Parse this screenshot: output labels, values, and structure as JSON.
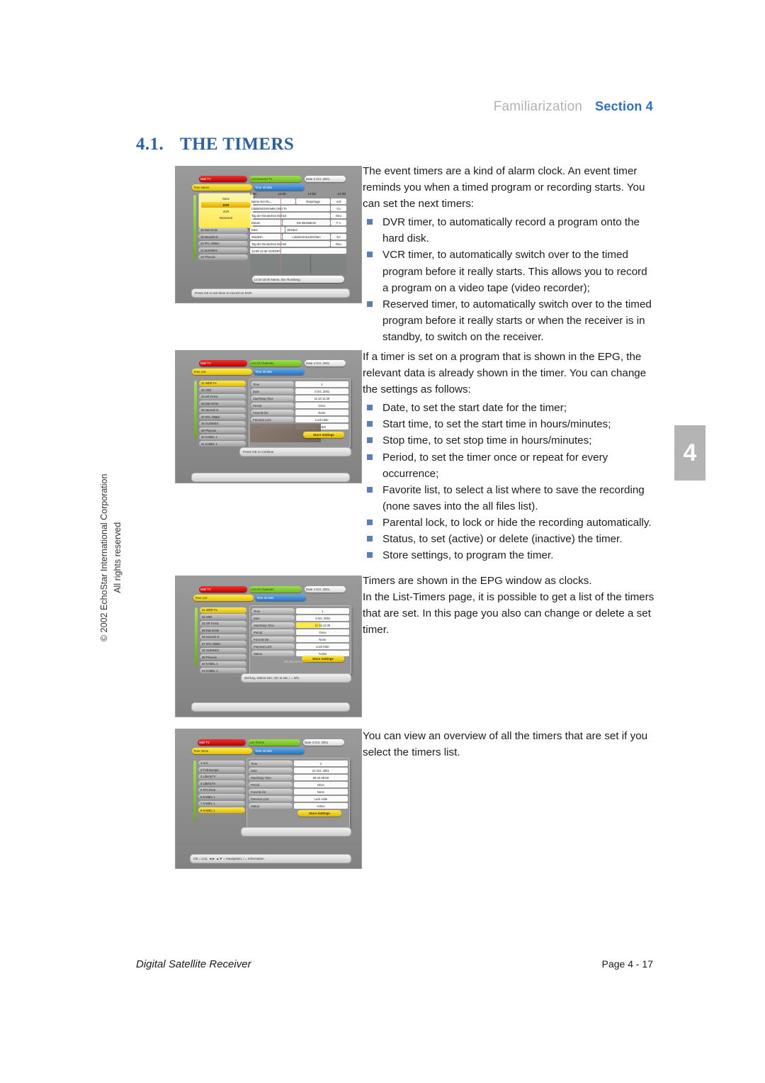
{
  "header": {
    "chapter": "Familiarization",
    "section": "Section 4"
  },
  "section_tab": {
    "number": "4"
  },
  "heading": {
    "number": "4.1.",
    "title": "THE TIMERS"
  },
  "copyright": {
    "line1": "© 2002 EchoStar International Corporation",
    "line2": "All rights reserved"
  },
  "body": {
    "p1": "The event timers are a kind of alarm clock. An event timer reminds you when a timed program or recording starts. You can set the next timers:",
    "list1": [
      "DVR timer, to automatically record a program onto the hard disk.",
      "VCR timer, to automatically switch over to the timed program before it really starts. This allows you to record a program on a video tape (video recorder);",
      "Reserved timer, to automatically switch over to the timed program before it really starts or when the receiver is in standby, to switch on the receiver."
    ],
    "p2": "If a timer is set on a program that is shown in the EPG, the relevant data is already shown in the timer. You can change the settings as follows:",
    "list2": [
      "Date, to set the start date for the timer;",
      "Start time, to set the start time in hours/minutes;",
      "Stop time, to set stop time in hours/minutes;",
      "Period, to set the timer once or repeat for every occurrence;",
      "Favorite list, to select a list where to save the recording (none saves into the all files list).",
      "Parental lock, to lock or hide the recording automatically.",
      "Status, to set (active) or delete (inactive) the timer.",
      "Store settings, to program the timer."
    ],
    "p3": "Timers are shown in the EPG window as clocks.",
    "p4": "In the List-Timers page, it is possible to get a list of the timers that are set. In this page you also can change or delete a set timer.",
    "p5": "You can view an overview of all the timers that are set if you select the timers list."
  },
  "screenshots": [
    {
      "id": "epg-timer-select",
      "caption_bar": "Press OK to set timer to record on DVR",
      "top_bars": {
        "red": "Mail        TV",
        "green": "List     General TV",
        "white": "Date  2 Oct. 2001"
      },
      "second_bars": {
        "yellow": "Time        Name",
        "blue": "Time      30 Min"
      },
      "timer_menu": [
        "None",
        "DVR",
        "VCR",
        "Reserved"
      ],
      "time_headers": [
        "5:00",
        "13:30",
        "14:00",
        "14:30"
      ],
      "channels": [
        "16  Das Erste",
        "16  Neuseh N",
        "20  RTL-GBBA",
        "11  SUDWES",
        "15  Phoenix"
      ],
      "epg_rows": [
        {
          "label": "Name  Der Ru...",
          "value": "Reportage",
          "tag": "Ard"
        },
        {
          "label": "LIEBENSGRAMM UND TA",
          "value": "",
          "tag": "Co"
        },
        {
          "label": "Tag der Deutschen Einheit",
          "value": "",
          "tag": "Deu"
        },
        {
          "label": "Datum",
          "value": "Die Bestatterin",
          "tag": "F 1"
        },
        {
          "label": "Date",
          "value": "Oktober",
          "tag": ""
        },
        {
          "label": "Wiederh.",
          "value": "Lokalzeit-Nachrichten",
          "tag": "Ko"
        },
        {
          "label": "Tag der Deutschen Einheit",
          "value": "",
          "tag": "Deu"
        },
        {
          "label": "14:00-14:45 VORORT",
          "value": "",
          "tag": ""
        }
      ],
      "event_bar": "14:15-15:00 Name, Der Rundweg"
    },
    {
      "id": "timer-settings",
      "caption_bar": "Press OK to continue",
      "top_bars": {
        "red": "Mail        TV",
        "green": "List     All Channels",
        "white": "Date  4 Oct. 2001"
      },
      "second_bars": {
        "yellow": "Time        List",
        "blue": "Time      30 Min"
      },
      "channels": [
        "31  WDR Fe",
        "32  ARD",
        "33  SR Ferns",
        "35  Das Erste",
        "36  Neuseh N",
        "37  RTL-GBBA",
        "38  SUDWES",
        "39  Phoenix",
        "40  KABEL 1",
        "41  KABEL 1"
      ],
      "settings": [
        {
          "label": "Time",
          "value": "1"
        },
        {
          "label": "Date",
          "value": "4 Oct. 2001"
        },
        {
          "label": "Start/Stop Time",
          "value": "11:10      11:30"
        },
        {
          "label": "Period",
          "value": "Once"
        },
        {
          "label": "Favorite list",
          "value": "None"
        },
        {
          "label": "Parental Lock",
          "value": "Lock        Hide"
        },
        {
          "label": "Status",
          "value": "Active"
        }
      ],
      "store_button": "Store Settings"
    },
    {
      "id": "timer-list-edit",
      "caption_bar": "Set key, Select min, OK to set, i = Info",
      "top_bars": {
        "red": "Mail        TV",
        "green": "List     All Channels",
        "white": "Date  4 Oct. 2001"
      },
      "second_bars": {
        "yellow": "Time        List",
        "blue": "Time      30 Min"
      },
      "channels": [
        "31  WDR Fe",
        "32  ARD",
        "33  SR Ferns",
        "35  Das Erste",
        "36  Neuseh N",
        "37  RTL-GBBA",
        "38  SUDWES",
        "39  Phoenix",
        "40  KABEL 1",
        "41  KABEL 1"
      ],
      "settings": [
        {
          "label": "Time",
          "value": "1"
        },
        {
          "label": "Date",
          "value": "4 Oct. 2001"
        },
        {
          "label": "Start/Stop Time",
          "value": "11:10      11:30"
        },
        {
          "label": "Period",
          "value": "Once"
        },
        {
          "label": "Favorite list",
          "value": "None"
        },
        {
          "label": "Parental Lock",
          "value": "Lock        Hide"
        },
        {
          "label": "Status",
          "value": "Active"
        }
      ],
      "hint": "Do the next point",
      "store_button": "Store Settings"
    },
    {
      "id": "timers-overview",
      "caption_bar": "OK = List,  ◄► ▲▼ = Navigation,  i = Information",
      "top_bars": {
        "red": "Mail        TV",
        "green": "List      Timers",
        "white": "Date 4 Oct. 2001"
      },
      "second_bars": {
        "yellow": "Time        None",
        "blue": "Time      30 Min"
      },
      "channels": [
        "1   Ard",
        "2   TV5 Europe",
        "3   LibertyTV",
        "4   LibertyTV",
        "5   RTL9/Sat",
        "6   KABEL 1",
        "7   KABEL 1",
        "8   KABEL 1"
      ],
      "settings": [
        {
          "label": "Time",
          "value": "4"
        },
        {
          "label": "Date",
          "value": "21 Oct. 2001"
        },
        {
          "label": "Start/Stop Time",
          "value": "08:44      08:58"
        },
        {
          "label": "Period",
          "value": "Once"
        },
        {
          "label": "Favorite list",
          "value": "None"
        },
        {
          "label": "Parental Lock",
          "value": "Lock        Hide"
        },
        {
          "label": "Status",
          "value": "Active"
        }
      ],
      "store_button": "Store Settings"
    }
  ],
  "footer": {
    "left": "Digital Satellite Receiver",
    "right": "Page 4 - 17"
  }
}
